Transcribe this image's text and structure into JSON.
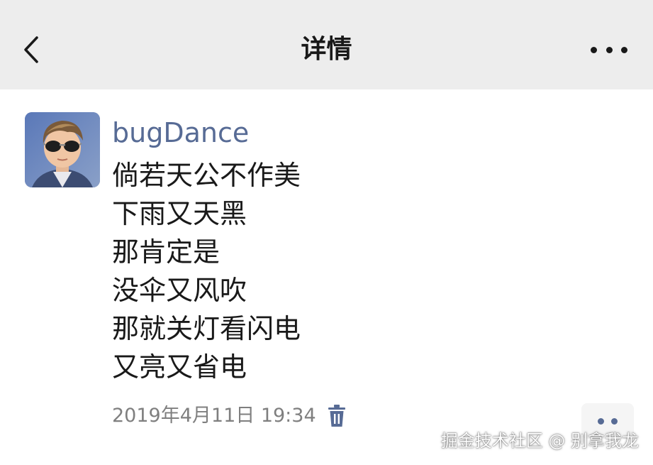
{
  "header": {
    "title": "详情",
    "back_icon": "chevron-left-icon",
    "more_icon": "more-horizontal-icon"
  },
  "post": {
    "username": "bugDance",
    "lines": [
      "倘若天公不作美",
      "下雨又天黑",
      "那肯定是",
      "没伞又风吹",
      "那就关灯看闪电",
      "又亮又省电"
    ],
    "timestamp": "2019年4月11日 19:34",
    "delete_icon": "trash-icon",
    "action_icon": "more-dots-icon"
  },
  "watermark": "掘金技术社区 @ 别拿我龙",
  "colors": {
    "navbar_bg": "#ededed",
    "username": "#576b95",
    "text": "#191919",
    "timestamp": "#7f7f7f"
  }
}
